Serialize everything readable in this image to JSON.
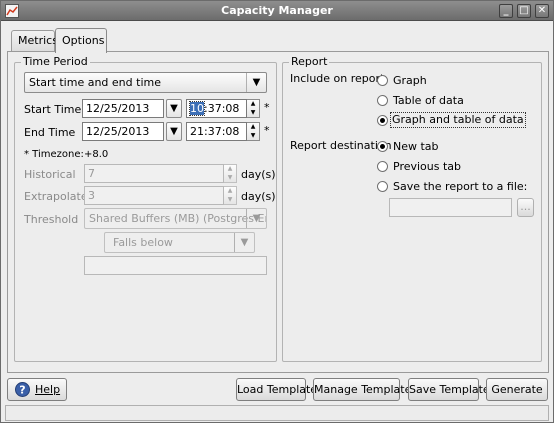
{
  "window": {
    "title": "Capacity Manager"
  },
  "tabs": [
    {
      "label": "Metrics"
    },
    {
      "label": "Options"
    }
  ],
  "time_period": {
    "group_title": "Time Period",
    "mode": "Start time and end time",
    "start_label": "Start Time",
    "start_date": "12/25/2013",
    "start_time_hour": "10",
    "start_time_rest": ":37:08",
    "end_label": "End Time",
    "end_date": "12/25/2013",
    "end_time": "21:37:08",
    "required_mark": "*",
    "timezone_label": "* Timezone:",
    "timezone_value": "+8.0",
    "historical_label": "Historical",
    "historical_value": "7",
    "historical_unit": "day(s)",
    "extrapolated_label": "Extrapolated",
    "extrapolated_value": "3",
    "extrapolated_unit": "day(s)",
    "threshold_label": "Threshold",
    "threshold_metric": "Shared Buffers (MB) (Postgres Enterp",
    "threshold_condition": "Falls below",
    "threshold_value": ""
  },
  "report": {
    "group_title": "Report",
    "include_label": "Include on report",
    "include_options": [
      {
        "label": "Graph",
        "checked": false
      },
      {
        "label": "Table of data",
        "checked": false
      },
      {
        "label": "Graph and table of data",
        "checked": true
      }
    ],
    "destination_label": "Report destination",
    "destination_options": [
      {
        "label": "New tab",
        "checked": true
      },
      {
        "label": "Previous tab",
        "checked": false
      },
      {
        "label": "Save the report to a file:",
        "checked": false
      }
    ],
    "file_path": "",
    "browse_label": "..."
  },
  "footer": {
    "help_label": "Help",
    "load_template_label": "Load Template",
    "manage_templates_label": "Manage Templates",
    "save_template_label": "Save Template",
    "generate_label": "Generate"
  },
  "status": {
    "text": ""
  },
  "colors": {
    "titlebar": "#7b7b7b",
    "selection": "#3d6fb6"
  }
}
